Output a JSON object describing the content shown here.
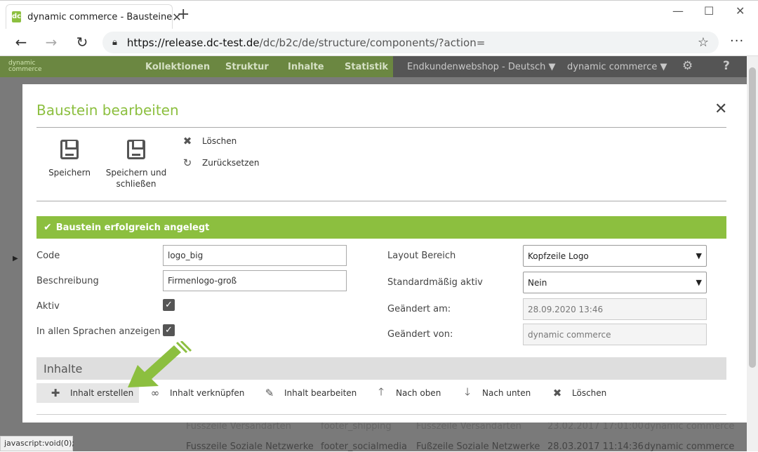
{
  "browser": {
    "tab_title": "dynamic commerce - Bausteine",
    "url_domain": "https://release.dc-test.de",
    "url_path": "/dc/b2c/de/structure/components/?action=",
    "status_text": "javascript:void(0);"
  },
  "app_nav": {
    "logo_text": "dynamic commerce",
    "items": [
      "Kollektionen",
      "Struktur",
      "Inhalte",
      "Statistik"
    ],
    "shop_select": "Endkundenwebshop - Deutsch",
    "user_select": "dynamic commerce"
  },
  "background_rows": [
    {
      "name": "Fusszeile Versandarten",
      "code": "footer_shipping",
      "area": "Fusszeile Versandarten",
      "date": "23.02.2017 17:01:00",
      "user": "dynamic commerce"
    },
    {
      "name": "Fusszeile Soziale Netzwerke",
      "code": "footer_socialmedia",
      "area": "Fußzeile Soziale Netzwerke",
      "date": "28.03.2017 11:14:36",
      "user": "dynamic commerce"
    }
  ],
  "modal": {
    "title": "Baustein bearbeiten",
    "toolbar": {
      "save_label": "Speichern",
      "save_close_label_1": "Speichern und",
      "save_close_label_2": "schließen",
      "delete_label": "Löschen",
      "reset_label": "Zurücksetzen"
    },
    "alert": "Baustein erfolgreich angelegt",
    "form": {
      "code_label": "Code",
      "code_value": "logo_big",
      "description_label": "Beschreibung",
      "description_value": "Firmenlogo-groß",
      "active_label": "Aktiv",
      "all_languages_label": "In allen Sprachen anzeigen",
      "layout_label": "Layout Bereich",
      "layout_value": "Kopfzeile Logo",
      "default_active_label": "Standardmäßig aktiv",
      "default_active_value": "Nein",
      "changed_at_label": "Geändert am:",
      "changed_at_value": "28.09.2020 13:46",
      "changed_by_label": "Geändert von:",
      "changed_by_value": "dynamic commerce"
    },
    "content_section": {
      "title": "Inhalte",
      "actions": [
        "Inhalt erstellen",
        "Inhalt verknüpfen",
        "Inhalt bearbeiten",
        "Nach oben",
        "Nach unten",
        "Löschen"
      ]
    }
  },
  "colors": {
    "brand_green": "#8cbf3f",
    "nav_dark": "#444444"
  }
}
